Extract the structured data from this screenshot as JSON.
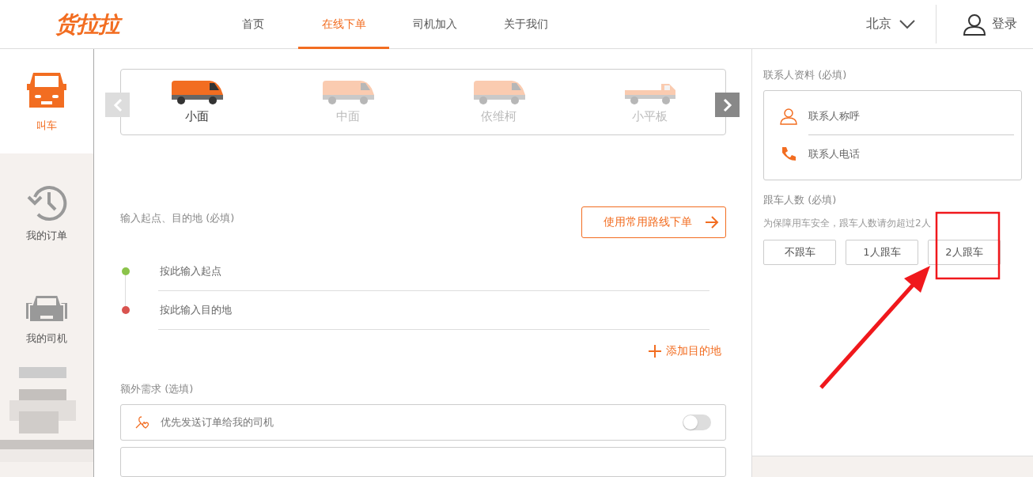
{
  "logo": "货拉拉",
  "nav": [
    {
      "label": "首页",
      "selected": false
    },
    {
      "label": "在线下单",
      "selected": true
    },
    {
      "label": "司机加入",
      "selected": false
    },
    {
      "label": "关于我们",
      "selected": false
    }
  ],
  "city": "北京",
  "login": "登录",
  "sidebar": [
    {
      "label": "叫车",
      "selected": true,
      "kind": "van"
    },
    {
      "label": "我的订单",
      "selected": false,
      "kind": "history"
    },
    {
      "label": "我的司机",
      "selected": false,
      "kind": "cars"
    },
    {
      "kind": "picture"
    }
  ],
  "vehicles": [
    {
      "label": "小面",
      "selected": true,
      "kind": "van"
    },
    {
      "label": "中面",
      "selected": false,
      "kind": "van"
    },
    {
      "label": "依维柯",
      "selected": false,
      "kind": "van"
    },
    {
      "label": "小平板",
      "selected": false,
      "kind": "flatbed"
    }
  ],
  "route": {
    "title": "输入起点、目的地 (必填)",
    "button": "使用常用路线下单",
    "stops": [
      {
        "placeholder": "按此输入起点",
        "color": "#8bc34a"
      },
      {
        "placeholder": "按此输入目的地",
        "color": "#d9534f"
      }
    ],
    "add": "添加目的地"
  },
  "extras": {
    "title": "额外需求 (选填)",
    "items": [
      {
        "label": "优先发送订单给我的司机",
        "on": false
      }
    ]
  },
  "contact": {
    "title": "联系人资料 (必填)",
    "fields": [
      {
        "placeholder": "联系人称呼",
        "kind": "person"
      },
      {
        "placeholder": "联系人电话",
        "kind": "phone"
      }
    ]
  },
  "riders": {
    "title": "跟车人数 (必填)",
    "hint": "为保障用车安全，跟车人数请勿超过2人",
    "options": [
      {
        "label": "不跟车",
        "selected": false
      },
      {
        "label": "1人跟车",
        "selected": false
      },
      {
        "label": "2人跟车",
        "selected": false
      }
    ]
  },
  "annotation": {
    "highlight_box": true,
    "arrow": true
  }
}
